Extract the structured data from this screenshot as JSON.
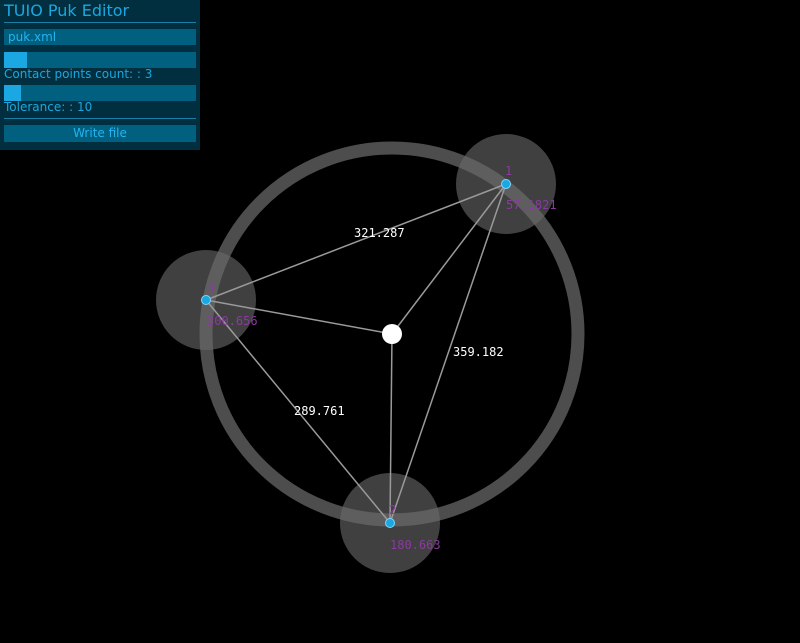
{
  "panel": {
    "title": "TUIO Puk Editor",
    "filename": "puk.xml",
    "contact_label": "Contact points count: : 3",
    "contact_fill": 0.12,
    "tolerance_label": "Tolerance: : 10",
    "tolerance_fill": 0.09,
    "write_button": "Write file"
  },
  "canvas": {
    "distances": [
      {
        "text": "321.287"
      },
      {
        "text": "359.182"
      },
      {
        "text": "289.761"
      }
    ],
    "points": [
      {
        "index": "1",
        "angle": "57.1821"
      },
      {
        "index": "2",
        "angle": "180.663"
      },
      {
        "index": "3",
        "angle": "300.656"
      }
    ]
  },
  "colors": {
    "accent": "#1ba7e2",
    "point_label": "#8a3aa0",
    "ring": "#5a5a5a"
  }
}
